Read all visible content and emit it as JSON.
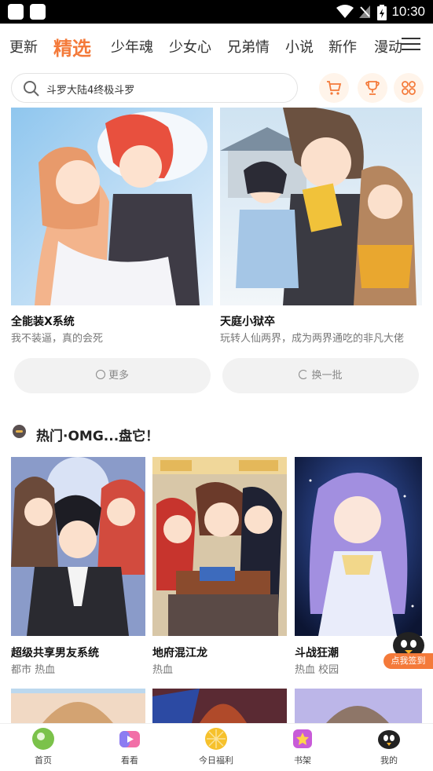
{
  "status_bar": {
    "time": "10:30"
  },
  "tabs": [
    "更新",
    "精选",
    "少年魂",
    "少女心",
    "兄弟情",
    "小说",
    "新作",
    "漫动"
  ],
  "active_tab": "精选",
  "search": {
    "placeholder": "斗罗大陆4终极斗罗"
  },
  "featured": [
    {
      "title": "全能装X系统",
      "subtitle": "我不装逼，真的会死"
    },
    {
      "title": "天庭小狱卒",
      "subtitle": "玩转人仙两界，成为两界通吃的非凡大佬"
    }
  ],
  "buttons": {
    "more": "更多",
    "refresh": "换一批"
  },
  "section": {
    "title": "热门·OMG...盘它！"
  },
  "hot": [
    {
      "title": "超级共享男友系统",
      "tags": "都市 热血"
    },
    {
      "title": "地府混江龙",
      "tags": "热血"
    },
    {
      "title": "斗战狂潮",
      "tags": "热血 校园"
    }
  ],
  "checkin": {
    "label": "点我签到"
  },
  "bottom_nav": [
    {
      "label": "首页",
      "icon": "home-icon"
    },
    {
      "label": "看看",
      "icon": "video-icon"
    },
    {
      "label": "今日福利",
      "icon": "welfare-icon"
    },
    {
      "label": "书架",
      "icon": "bookshelf-icon"
    },
    {
      "label": "我的",
      "icon": "profile-icon"
    }
  ],
  "colors": {
    "accent": "#f47a3a",
    "pill_bg": "#f2f2f2"
  }
}
